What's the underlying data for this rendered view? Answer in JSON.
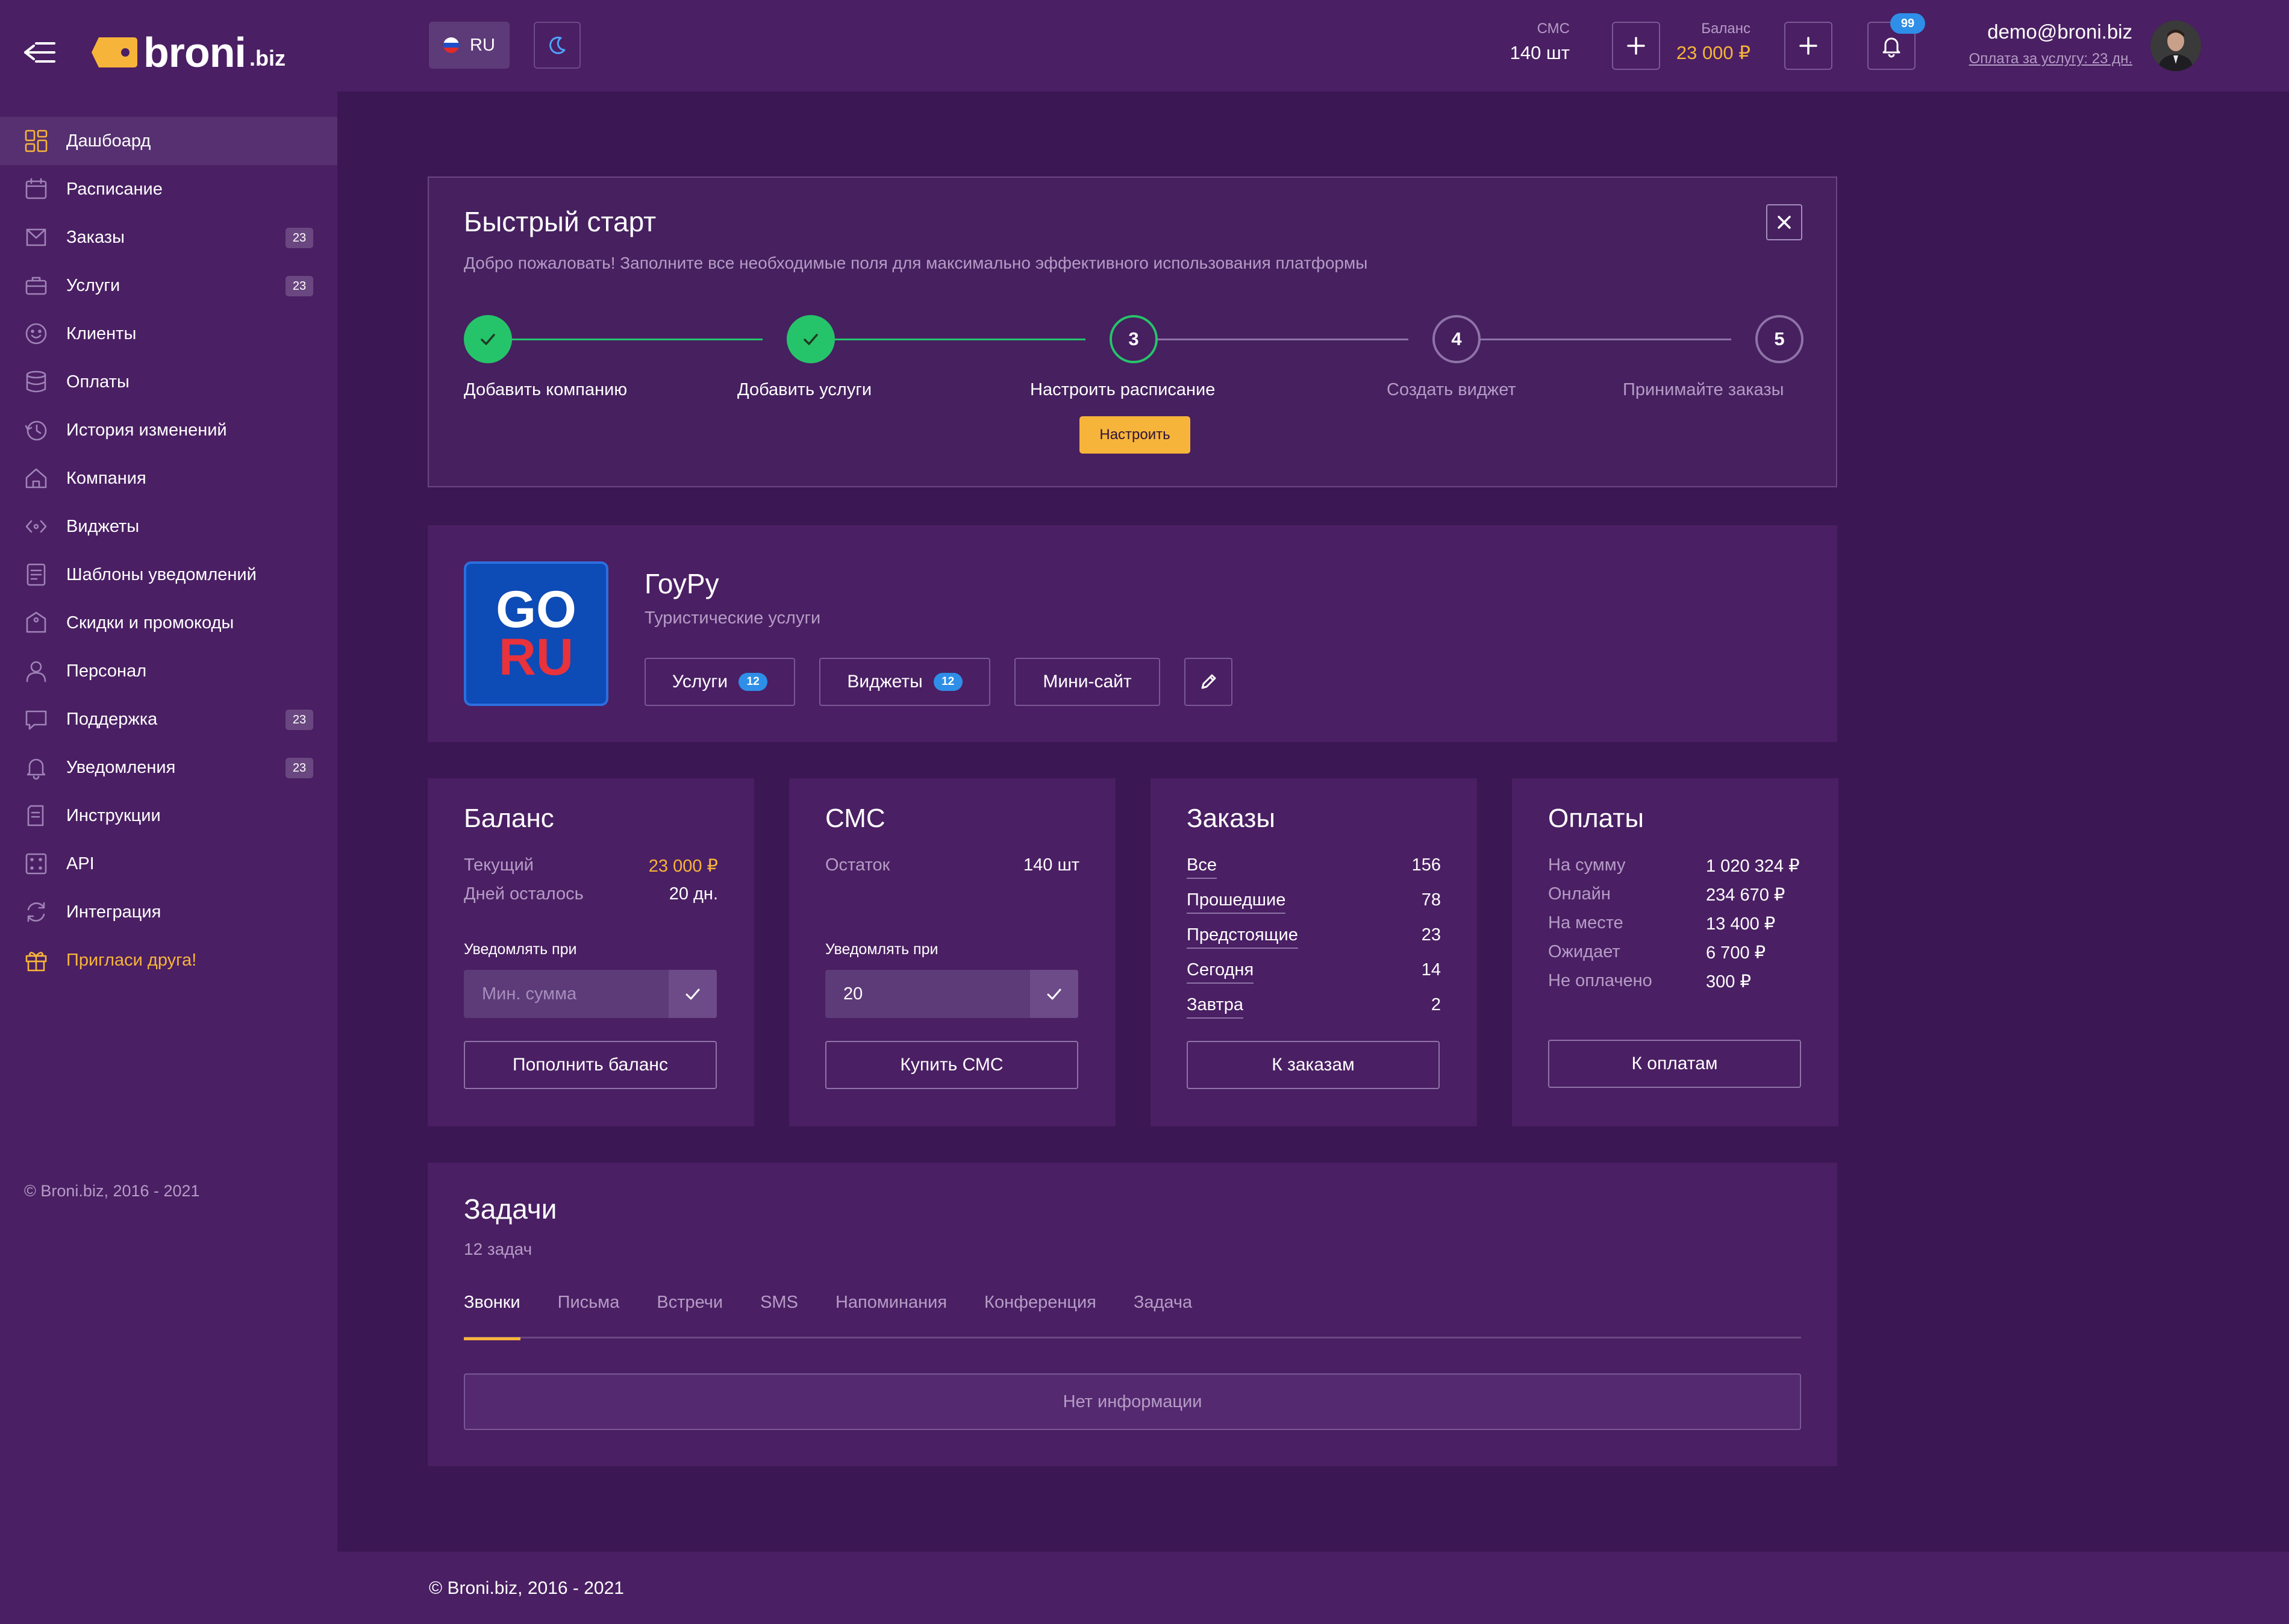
{
  "brand": {
    "name": "broni",
    "tld": ".biz"
  },
  "sidebar": {
    "items": [
      {
        "label": "Дашбоард",
        "icon": "dashboard-icon",
        "badge": null,
        "active": true
      },
      {
        "label": "Расписание",
        "icon": "calendar-icon",
        "badge": null
      },
      {
        "label": "Заказы",
        "icon": "orders-icon",
        "badge": "23"
      },
      {
        "label": "Услуги",
        "icon": "briefcase-icon",
        "badge": "23"
      },
      {
        "label": "Клиенты",
        "icon": "smile-icon",
        "badge": null
      },
      {
        "label": "Оплаты",
        "icon": "database-icon",
        "badge": null
      },
      {
        "label": "История изменений",
        "icon": "history-icon",
        "badge": null
      },
      {
        "label": "Компания",
        "icon": "home-icon",
        "badge": null
      },
      {
        "label": "Виджеты",
        "icon": "widget-icon",
        "badge": null
      },
      {
        "label": "Шаблоны уведомлений",
        "icon": "template-icon",
        "badge": null
      },
      {
        "label": "Скидки и промокоды",
        "icon": "tag-icon",
        "badge": null
      },
      {
        "label": "Персонал",
        "icon": "user-icon",
        "badge": null
      },
      {
        "label": "Поддержка",
        "icon": "chat-icon",
        "badge": "23"
      },
      {
        "label": "Уведомления",
        "icon": "bell-icon",
        "badge": "23"
      },
      {
        "label": "Инструкции",
        "icon": "docs-icon",
        "badge": null
      },
      {
        "label": "API",
        "icon": "api-icon",
        "badge": null
      },
      {
        "label": "Интеграция",
        "icon": "sync-icon",
        "badge": null
      },
      {
        "label": "Пригласи друга!",
        "icon": "gift-icon",
        "badge": null,
        "highlight": true
      }
    ],
    "copyright": "© Broni.biz, 2016 - 2021"
  },
  "header": {
    "lang": "RU",
    "sms": {
      "label": "СМС",
      "value": "140 шт"
    },
    "balance": {
      "label": "Баланс",
      "value": "23 000 ₽"
    },
    "notifications_count": "99",
    "user_email": "demo@broni.biz",
    "user_payment": "Оплата за услугу: 23 дн."
  },
  "quickstart": {
    "title": "Быстрый старт",
    "description": "Добро пожаловать! Заполните все необходимые поля для максимально эффективного использования платформы",
    "steps": [
      {
        "num": "1",
        "label": "Добавить компанию",
        "state": "done"
      },
      {
        "num": "2",
        "label": "Добавить услуги",
        "state": "done"
      },
      {
        "num": "3",
        "label": "Настроить расписание",
        "state": "current"
      },
      {
        "num": "4",
        "label": "Создать виджет",
        "state": "pending"
      },
      {
        "num": "5",
        "label": "Принимайте заказы",
        "state": "pending"
      }
    ],
    "setup_button": "Настроить"
  },
  "company": {
    "logo_line1": "GO",
    "logo_line2": "RU",
    "name": "ГоуРу",
    "type": "Туристические услуги",
    "buttons": {
      "services": {
        "label": "Услуги",
        "badge": "12"
      },
      "widgets": {
        "label": "Виджеты",
        "badge": "12"
      },
      "minisite": {
        "label": "Мини-сайт"
      }
    }
  },
  "balance_card": {
    "title": "Баланс",
    "current_label": "Текущий",
    "current_value": "23 000 ₽",
    "days_label": "Дней осталось",
    "days_value": "20 дн.",
    "notify_label": "Уведомлять при",
    "notify_placeholder": "Мин. сумма",
    "button": "Пополнить баланс"
  },
  "sms_card": {
    "title": "СМС",
    "remain_label": "Остаток",
    "remain_value": "140 шт",
    "notify_label": "Уведомлять при",
    "notify_value": "20",
    "button": "Купить СМС"
  },
  "orders_card": {
    "title": "Заказы",
    "rows": [
      {
        "label": "Все",
        "value": "156"
      },
      {
        "label": "Прошедшие",
        "value": "78"
      },
      {
        "label": "Предстоящие",
        "value": "23"
      },
      {
        "label": "Сегодня",
        "value": "14"
      },
      {
        "label": "Завтра",
        "value": "2"
      }
    ],
    "button": "К заказам"
  },
  "payments_card": {
    "title": "Оплаты",
    "rows": [
      {
        "label": "На сумму",
        "value": "1 020 324 ₽"
      },
      {
        "label": "Онлайн",
        "value": "234 670 ₽"
      },
      {
        "label": "На месте",
        "value": "13 400 ₽"
      },
      {
        "label": "Ожидает",
        "value": "6 700 ₽"
      },
      {
        "label": "Не оплачено",
        "value": "300 ₽"
      }
    ],
    "button": "К оплатам"
  },
  "tasks": {
    "title": "Задачи",
    "count": "12 задач",
    "tabs": [
      "Звонки",
      "Письма",
      "Встречи",
      "SMS",
      "Напоминания",
      "Конференция",
      "Задача"
    ],
    "active_tab": 0,
    "empty_text": "Нет информации"
  },
  "footer": {
    "copyright": "© Broni.biz, 2016 - 2021"
  },
  "colors": {
    "accent": "#f7b43a",
    "success": "#26c46a",
    "badge_blue": "#2f8ee8",
    "bg": "#3b1754",
    "panel": "#4a1f63"
  }
}
